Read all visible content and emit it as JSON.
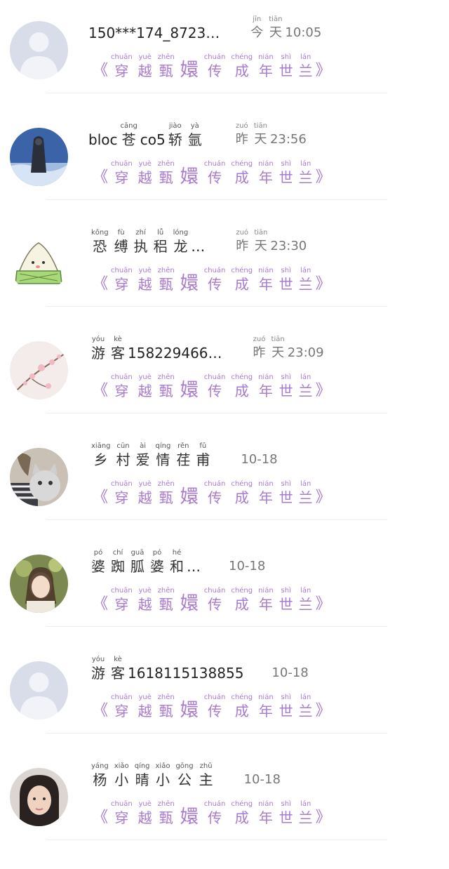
{
  "list": {
    "subtitle": {
      "open_mark": "《",
      "close_mark": "》",
      "chars": [
        {
          "char": "穿",
          "pinyin": "chuān"
        },
        {
          "char": "越",
          "pinyin": "yuè"
        },
        {
          "char": "甄",
          "pinyin": "zhēn"
        },
        {
          "char": "嬛",
          "pinyin": ""
        },
        {
          "char": "传",
          "pinyin": "chuán"
        },
        {
          "char": "成",
          "pinyin": "chéng"
        },
        {
          "char": "年",
          "pinyin": "nián"
        },
        {
          "char": "世",
          "pinyin": "shì"
        },
        {
          "char": "兰",
          "pinyin": "lán"
        }
      ]
    },
    "items": [
      {
        "avatar_icon": "default-person-icon",
        "name_prefix": "150***174_8723…",
        "name_chars": [],
        "name_suffix": "",
        "time_chars": [
          {
            "char": "今",
            "pinyin": "jīn"
          },
          {
            "char": "天",
            "pinyin": "tiān"
          }
        ],
        "time_text": "10:05"
      },
      {
        "avatar_icon": "cloaked-figure-icon",
        "name_prefix": "bloc",
        "name_chars": [
          {
            "char": "苍",
            "pinyin": "cāng"
          }
        ],
        "name_mid": "co5",
        "name_chars2": [
          {
            "char": "轿",
            "pinyin": "jiào"
          },
          {
            "char": "氩",
            "pinyin": "yà"
          }
        ],
        "time_chars": [
          {
            "char": "昨",
            "pinyin": "zuó"
          },
          {
            "char": "天",
            "pinyin": "tiān"
          }
        ],
        "time_text": "23:56"
      },
      {
        "avatar_icon": "rice-dumpling-icon",
        "name_prefix": "",
        "name_chars": [
          {
            "char": "恐",
            "pinyin": "kǒng"
          },
          {
            "char": "缚",
            "pinyin": "fù"
          },
          {
            "char": "执",
            "pinyin": "zhí"
          },
          {
            "char": "稆",
            "pinyin": "lǚ"
          },
          {
            "char": "龙",
            "pinyin": "lóng"
          }
        ],
        "name_suffix": "…",
        "time_chars": [
          {
            "char": "昨",
            "pinyin": "zuó"
          },
          {
            "char": "天",
            "pinyin": "tiān"
          }
        ],
        "time_text": "23:30"
      },
      {
        "avatar_icon": "plum-blossom-icon",
        "name_prefix": "",
        "name_chars": [
          {
            "char": "游",
            "pinyin": "yóu"
          },
          {
            "char": "客",
            "pinyin": "kè"
          }
        ],
        "name_suffix": "158229466…",
        "time_chars": [
          {
            "char": "昨",
            "pinyin": "zuó"
          },
          {
            "char": "天",
            "pinyin": "tiān"
          }
        ],
        "time_text": "23:09"
      },
      {
        "avatar_icon": "cat-photo-icon",
        "name_prefix": "",
        "name_chars": [
          {
            "char": "乡",
            "pinyin": "xiāng"
          },
          {
            "char": "村",
            "pinyin": "cūn"
          },
          {
            "char": "爱",
            "pinyin": "ài"
          },
          {
            "char": "情",
            "pinyin": "qíng"
          },
          {
            "char": "荏",
            "pinyin": "rěn"
          },
          {
            "char": "甫",
            "pinyin": "fǔ"
          }
        ],
        "name_suffix": "",
        "time_chars": [],
        "time_text": "10-18"
      },
      {
        "avatar_icon": "girl-photo-icon",
        "name_prefix": "",
        "name_chars": [
          {
            "char": "婆",
            "pinyin": "pó"
          },
          {
            "char": "踟",
            "pinyin": "chí"
          },
          {
            "char": "胍",
            "pinyin": "guā"
          },
          {
            "char": "婆",
            "pinyin": "pó"
          },
          {
            "char": "和",
            "pinyin": "hé"
          }
        ],
        "name_suffix": "…",
        "time_chars": [],
        "time_text": "10-18"
      },
      {
        "avatar_icon": "default-person-icon",
        "name_prefix": "",
        "name_chars": [
          {
            "char": "游",
            "pinyin": "yóu"
          },
          {
            "char": "客",
            "pinyin": "kè"
          }
        ],
        "name_suffix": "1618115138855",
        "time_chars": [],
        "time_text": "10-18"
      },
      {
        "avatar_icon": "woman-portrait-icon",
        "name_prefix": "",
        "name_chars": [
          {
            "char": "杨",
            "pinyin": "yáng"
          },
          {
            "char": "小",
            "pinyin": "xiǎo"
          },
          {
            "char": "晴",
            "pinyin": "qíng"
          },
          {
            "char": "小",
            "pinyin": "xiǎo"
          },
          {
            "char": "公",
            "pinyin": "gōng"
          },
          {
            "char": "主",
            "pinyin": "zhǔ"
          }
        ],
        "name_suffix": "",
        "time_chars": [],
        "time_text": "10-18"
      }
    ]
  }
}
